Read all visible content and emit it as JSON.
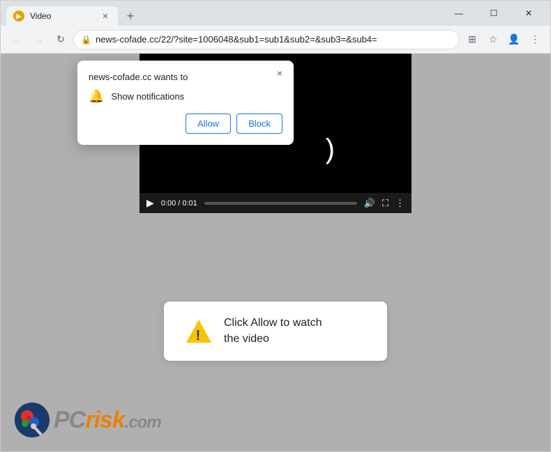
{
  "browser": {
    "tab": {
      "title": "Video",
      "favicon": "▶"
    },
    "new_tab_label": "+",
    "window_controls": {
      "minimize": "—",
      "maximize": "☐",
      "close": "✕"
    },
    "nav": {
      "back": "←",
      "forward": "→",
      "refresh": "↻",
      "address": "news-cofade.cc/22/?site=1006048&sub1=sub1&sub2=&sub3=&sub4=",
      "extensions_icon": "⊞",
      "bookmarks_icon": "☆",
      "profile_icon": "◉",
      "menu_icon": "⋮"
    }
  },
  "notification_popup": {
    "title": "news-cofade.cc wants to",
    "permission_label": "Show notifications",
    "allow_label": "Allow",
    "block_label": "Block",
    "close_label": "×"
  },
  "video": {
    "time_current": "0:00",
    "time_total": "0:01",
    "play_icon": "▶",
    "volume_icon": "🔊",
    "fullscreen_icon": "⛶",
    "more_icon": "⋮"
  },
  "click_allow_box": {
    "message_line1": "Click Allow to watch",
    "message_line2": "the video"
  },
  "pcrisk": {
    "text_pc": "PC",
    "text_risk": "risk",
    "text_com": ".com"
  }
}
